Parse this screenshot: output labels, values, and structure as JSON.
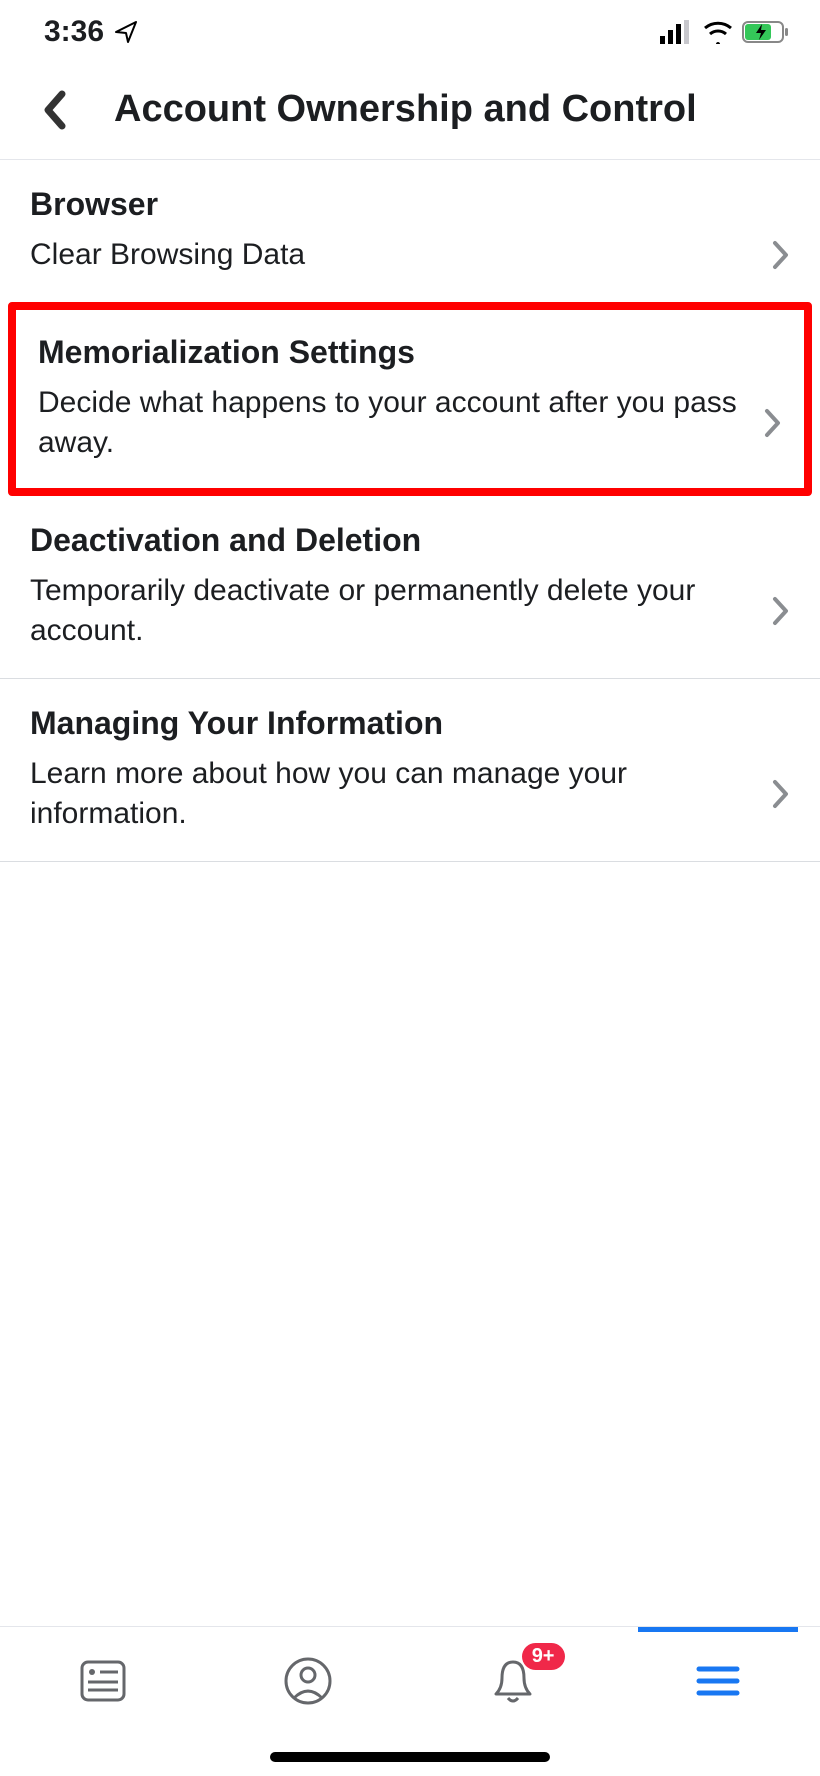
{
  "status": {
    "time": "3:36"
  },
  "nav": {
    "title": "Account Ownership and Control"
  },
  "sections": {
    "browser": {
      "title": "Browser",
      "row": "Clear Browsing Data"
    },
    "memorial": {
      "title": "Memorialization Settings",
      "desc": "Decide what happens to your account after you pass away."
    },
    "deact": {
      "title": "Deactivation and Deletion",
      "desc": "Temporarily deactivate or permanently delete your account."
    },
    "manage": {
      "title": "Managing Your Information",
      "desc": "Learn more about how you can manage your information."
    }
  },
  "bottom": {
    "badge": "9+"
  }
}
